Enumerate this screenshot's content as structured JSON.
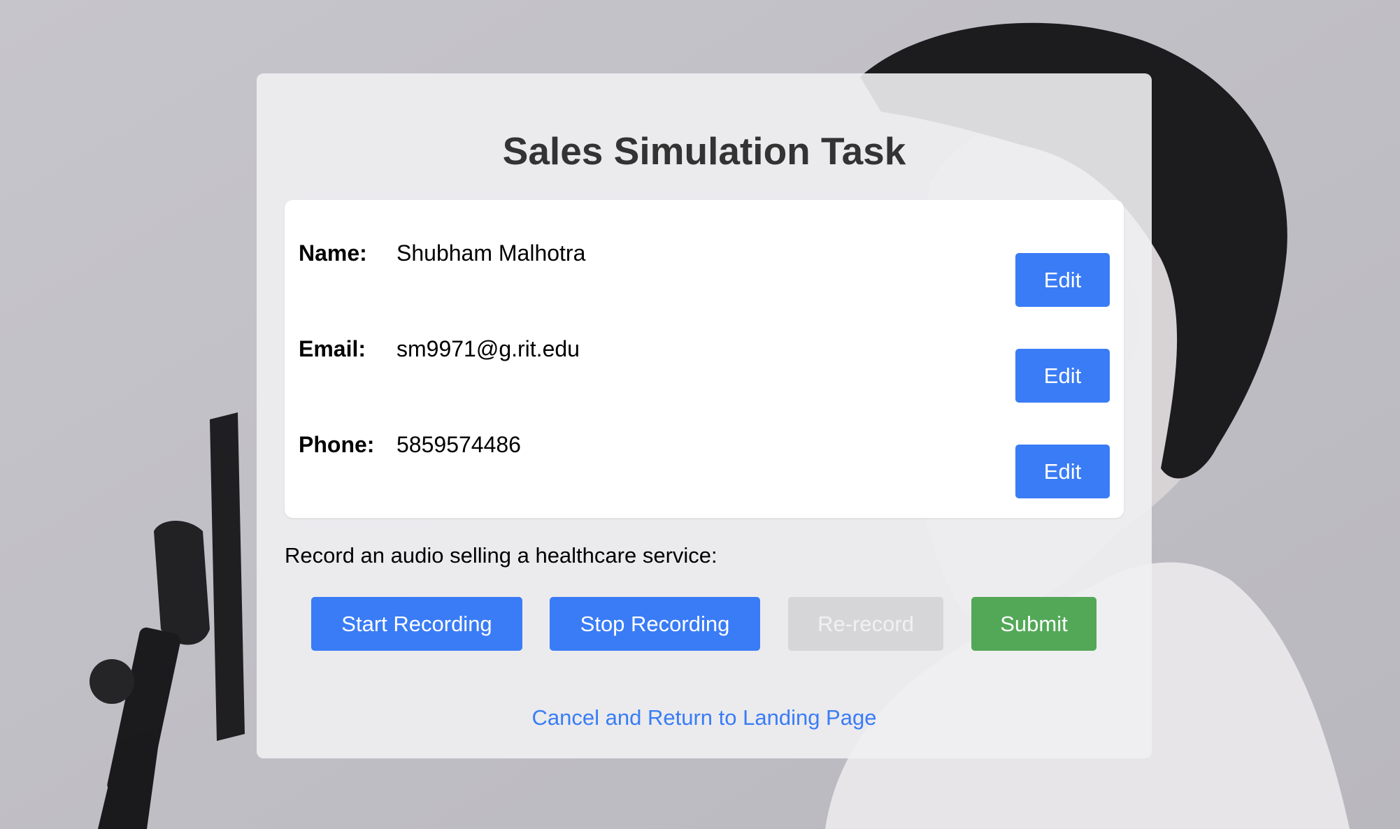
{
  "page": {
    "title": "Sales Simulation Task"
  },
  "info": {
    "rows": [
      {
        "label": "Name:",
        "value": "Shubham Malhotra",
        "edit_label": "Edit"
      },
      {
        "label": "Email:",
        "value": "sm9971@g.rit.edu",
        "edit_label": "Edit"
      },
      {
        "label": "Phone:",
        "value": "5859574486",
        "edit_label": "Edit"
      }
    ]
  },
  "recording": {
    "prompt": "Record an audio selling a healthcare service:",
    "start_label": "Start Recording",
    "stop_label": "Stop Recording",
    "rerecord_label": "Re-record",
    "submit_label": "Submit"
  },
  "footer": {
    "cancel_label": "Cancel and Return to Landing Page"
  },
  "colors": {
    "primary": "#3a7cf6",
    "success": "#53a857",
    "disabled": "#d6d6d8",
    "background": "#c4c3c9"
  }
}
